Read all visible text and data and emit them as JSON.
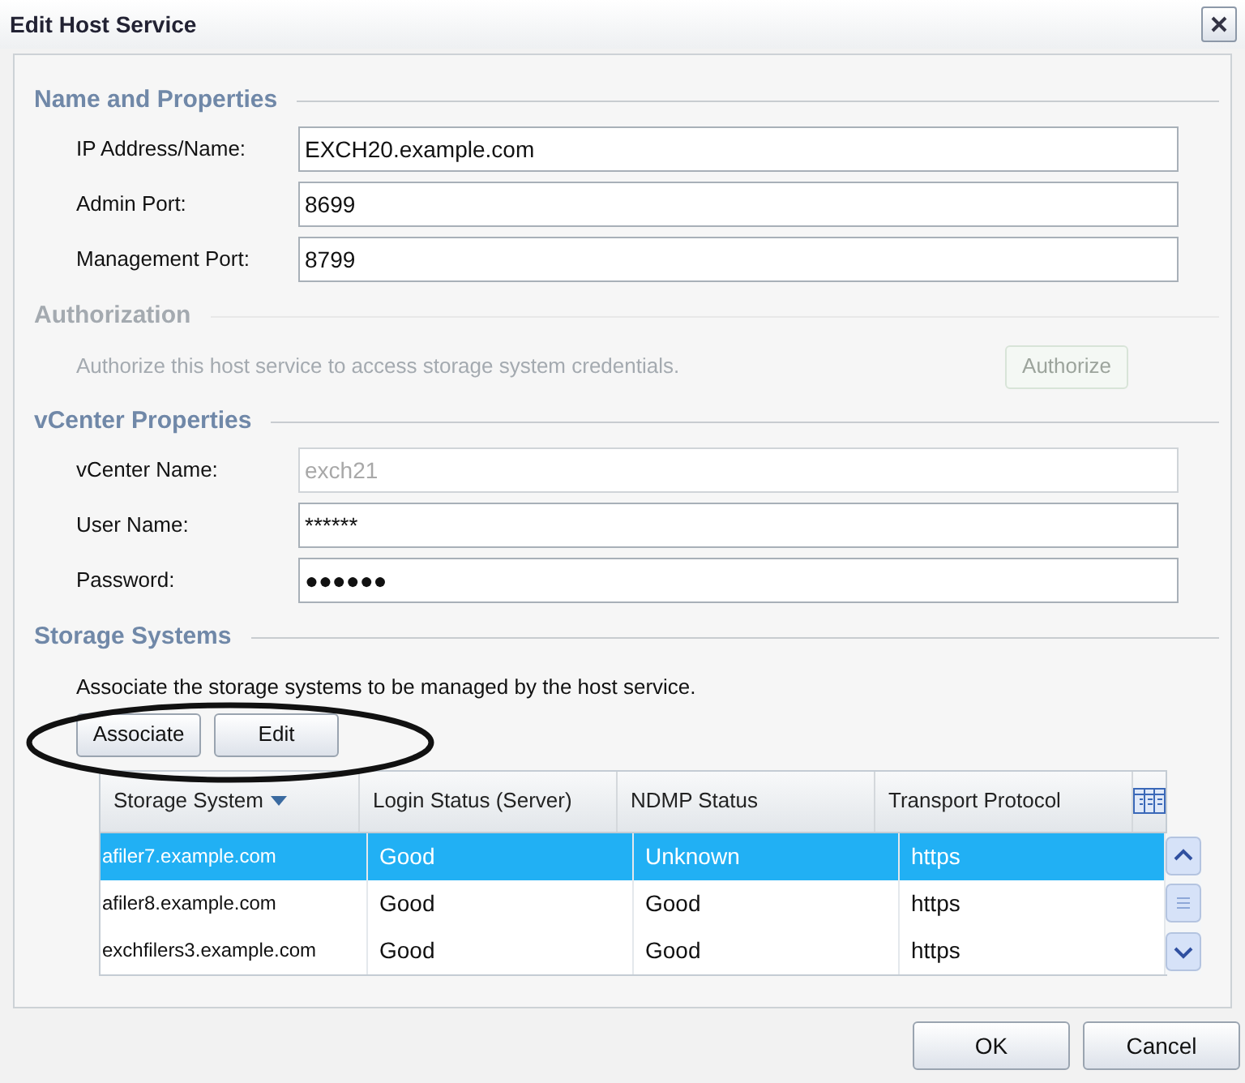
{
  "window": {
    "title": "Edit Host Service"
  },
  "sections": [
    {
      "kind": "fields",
      "title": "Name and Properties",
      "disabled": false,
      "fields": [
        {
          "label": "IP Address/Name:",
          "value": "EXCH20.example.com",
          "disabled": false
        },
        {
          "label": "Admin Port:",
          "value": "8699",
          "disabled": false
        },
        {
          "label": "Management Port:",
          "value": "8799",
          "disabled": false
        }
      ]
    },
    {
      "kind": "action",
      "title": "Authorization",
      "disabled": true,
      "description": "Authorize this host service to access storage system credentials.",
      "button": "Authorize"
    },
    {
      "kind": "fields",
      "title": "vCenter Properties",
      "disabled": false,
      "fields": [
        {
          "label": "vCenter Name:",
          "value": "exch21",
          "disabled": true
        },
        {
          "label": "User Name:",
          "value": "******",
          "disabled": false
        },
        {
          "label": "Password:",
          "value": "●●●●●●",
          "disabled": false
        }
      ]
    },
    {
      "kind": "table",
      "title": "Storage Systems",
      "disabled": false,
      "description": "Associate the storage systems to be managed by the host service.",
      "buttons": [
        "Associate",
        "Edit"
      ],
      "table": {
        "columns": [
          {
            "label": "Storage System",
            "sorted": true
          },
          {
            "label": "Login Status (Server)",
            "sorted": false
          },
          {
            "label": "NDMP Status",
            "sorted": false
          },
          {
            "label": "Transport Protocol",
            "sorted": false
          }
        ],
        "rows": [
          {
            "selected": true,
            "cells": [
              "afiler7.example.com",
              "Good",
              "Unknown",
              "https"
            ]
          },
          {
            "selected": false,
            "cells": [
              "afiler8.example.com",
              "Good",
              "Good",
              "https"
            ]
          },
          {
            "selected": false,
            "cells": [
              "exchfilers3.example.com",
              "Good",
              "Good",
              "https"
            ]
          }
        ]
      }
    }
  ],
  "buttons": [
    "OK",
    "Cancel"
  ]
}
